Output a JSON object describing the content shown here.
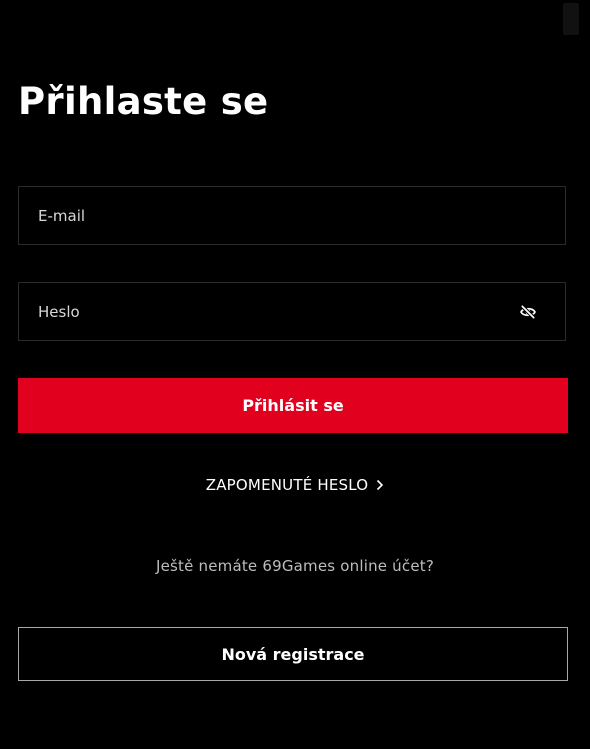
{
  "header": {
    "title": "Přihlaste se"
  },
  "form": {
    "email": {
      "placeholder": "E-mail",
      "value": ""
    },
    "password": {
      "placeholder": "Heslo",
      "value": "",
      "toggle_icon": "eye-off-icon"
    },
    "login_label": "Přihlásit se",
    "forgot_label": "ZAPOMENUTÉ HESLO",
    "forgot_icon": "chevron-right-icon"
  },
  "register": {
    "prompt": "Ještě nemáte 69Games online účet?",
    "button_label": "Nová registrace"
  },
  "colors": {
    "background": "#000000",
    "accent": "#e2001f",
    "field_border": "#2b2b2b",
    "register_border": "#a8a8a8",
    "muted_text": "#bdbdbd"
  }
}
